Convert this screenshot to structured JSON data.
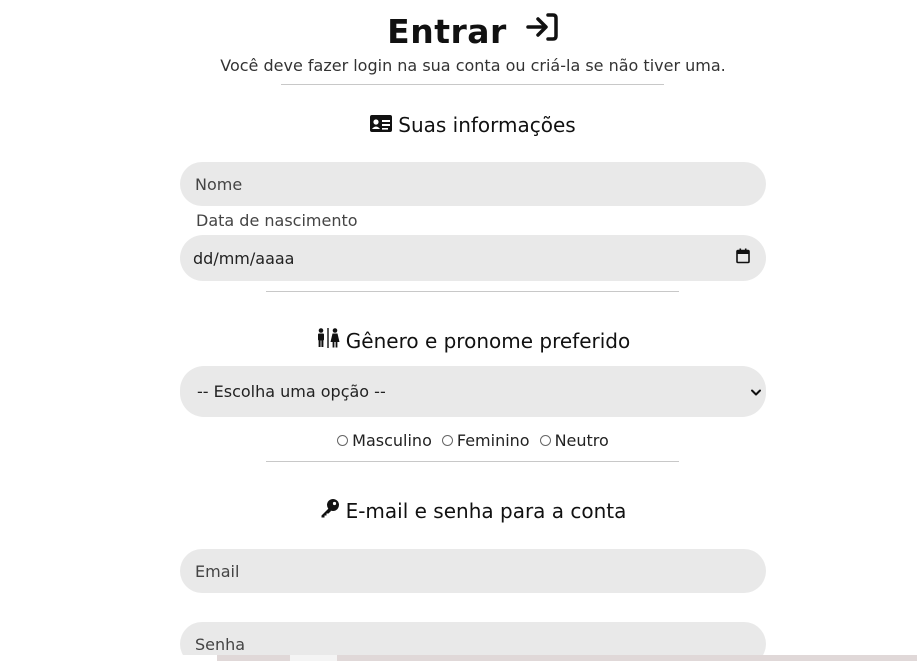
{
  "header": {
    "title": "Entrar",
    "title_icon": "login-arrow-icon",
    "subtitle": "Você deve fazer login na sua conta ou criá-la se não tiver uma."
  },
  "sections": {
    "info": {
      "heading": "Suas informações",
      "icon": "id-card-icon",
      "name_placeholder": "Nome",
      "birth_label": "Data de nascimento",
      "birth_value": "dd/mm/aaaa",
      "birth_icon": "calendar-icon"
    },
    "gender": {
      "heading": "Gênero e pronome preferido",
      "icon": "restroom-icon",
      "select_value": "-- Escolha uma opção --",
      "radios": [
        "Masculino",
        "Feminino",
        "Neutro"
      ]
    },
    "account": {
      "heading": "E-mail e senha para a conta",
      "icon": "key-icon",
      "email_placeholder": "Email",
      "password_placeholder": "Senha"
    }
  },
  "colors": {
    "field_bg": "#e9e9e9",
    "divider": "#c8c8c8",
    "text": "#111111"
  }
}
